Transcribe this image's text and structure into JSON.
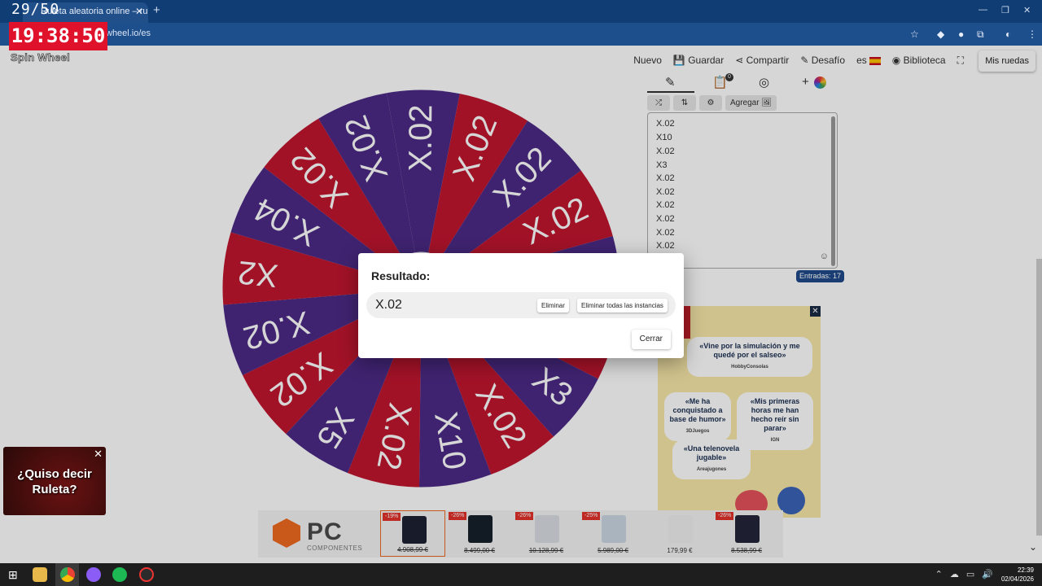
{
  "recording": {
    "counter": "29/50",
    "clock": "19:38:50"
  },
  "browser": {
    "tab_title": "Ruleta aleatoria online – ruleta",
    "tab_close": "✕",
    "new_tab": "+",
    "url": "wheel.io/es",
    "icons": [
      "star-icon",
      "extension-icon",
      "profile-icon",
      "menu-icon"
    ]
  },
  "header": {
    "logo": "Spin Wheel",
    "nav": [
      "Nuevo",
      "Guardar",
      "Compartir",
      "Desafío",
      "es",
      "Biblioteca"
    ],
    "my_wheels": "Mis ruedas"
  },
  "wheel": {
    "colors": {
      "red": "#c0162f",
      "purple": "#4c2a86",
      "text": "#ffffff"
    },
    "segments": [
      "X.02",
      "X.02",
      "X.02",
      "X.02",
      "X2",
      "X.02",
      "X3",
      "X.02",
      "X10",
      "X.02",
      "X5",
      "X.02",
      "X.02",
      "X2",
      "X.04",
      "X.02",
      "X.02"
    ]
  },
  "editor": {
    "tab_icons": [
      "pencil-icon",
      "clipboard-icon",
      "eye-off-icon",
      "palette-icon"
    ],
    "clipboard_badge": "0",
    "tools": {
      "shuffle": "⤮",
      "sort": "⇅",
      "settings": "⚙",
      "add_image": "Agregar 🖼"
    },
    "entries": [
      "X.02",
      "X10",
      "X.02",
      "X3",
      "X.02",
      "X.02",
      "X.02",
      "X.02",
      "X.02",
      "X.02"
    ],
    "emoji": "☺",
    "count_label": "Entradas: 17"
  },
  "modal": {
    "title": "Resultado:",
    "result": "X.02",
    "remove_label": "Eliminar",
    "remove_all_label": "Eliminar todas las instancias",
    "close_label": "Cerrar"
  },
  "ad_right": {
    "quotes": [
      {
        "text": "«Vine por la simulación y me quedé por el salseo»",
        "source": "HobbyConsolas"
      },
      {
        "text": "«Me ha conquistado a base de humor»",
        "source": "3DJuegos"
      },
      {
        "text": "«Mis primeras horas me han hecho reír sin parar»",
        "source": "IGN"
      },
      {
        "text": "«Una telenovela jugable»",
        "source": "Areajugones"
      }
    ]
  },
  "ad_left": {
    "text": "¿Quiso decir Ruleta?",
    "close": "✕"
  },
  "ad_bottom": {
    "brand": "PC",
    "brand_sub": "COMPONENTES",
    "products": [
      {
        "discount": "-19%",
        "price": "4.908,99 €",
        "strike": true,
        "color": "#1d2233"
      },
      {
        "discount": "-26%",
        "price": "8.499,00 €",
        "strike": true,
        "color": "#16202c"
      },
      {
        "discount": "-26%",
        "price": "10.128,99 €",
        "strike": true,
        "color": "#d9dde2"
      },
      {
        "discount": "-25%",
        "price": "5.989,00 €",
        "strike": true,
        "color": "#cbd7e4"
      },
      {
        "discount": "",
        "price": "179,99 €",
        "strike": false,
        "color": "#f0f0f0"
      },
      {
        "discount": "-26%",
        "price": "8.538,99 €",
        "strike": true,
        "color": "#23263a"
      }
    ]
  },
  "taskbar": {
    "time": "22:39",
    "date": "02/04/2026",
    "tray_icons": [
      "chevron-up-icon",
      "cloud-icon",
      "network-icon",
      "volume-icon"
    ]
  }
}
